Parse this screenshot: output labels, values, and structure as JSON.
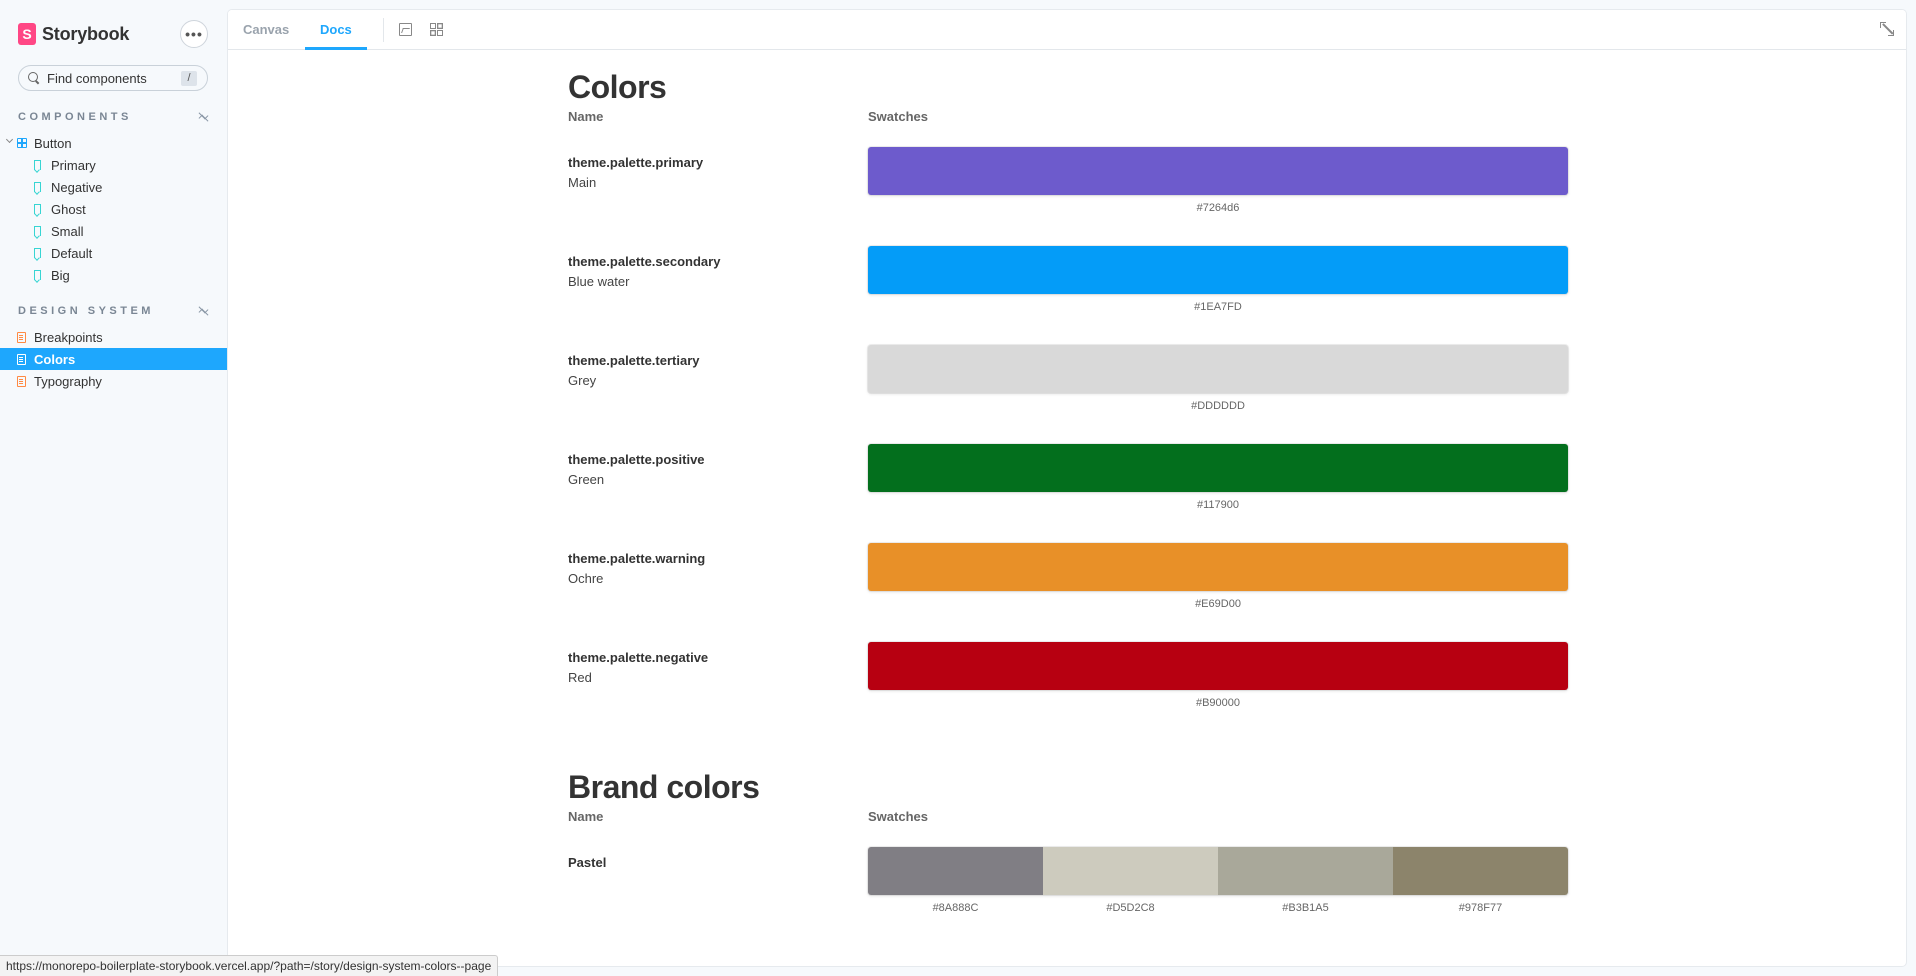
{
  "app": {
    "name": "Storybook",
    "menu_label": "•••"
  },
  "search": {
    "placeholder": "Find components",
    "shortcut": "/"
  },
  "sidebar": {
    "components_heading": "COMPONENTS",
    "component_group": "Button",
    "stories": [
      "Primary",
      "Negative",
      "Ghost",
      "Small",
      "Default",
      "Big"
    ],
    "design_heading": "DESIGN SYSTEM",
    "docs": [
      "Breakpoints",
      "Colors",
      "Typography"
    ],
    "active_doc": "Colors"
  },
  "toolbar": {
    "tabs": [
      "Canvas",
      "Docs"
    ],
    "active_tab": "Docs"
  },
  "colors_section": {
    "title": "Colors",
    "col_name": "Name",
    "col_swatches": "Swatches",
    "rows": [
      {
        "name": "theme.palette.primary",
        "desc": "Main",
        "hex": "#7264d6",
        "color": "#6d5bcc"
      },
      {
        "name": "theme.palette.secondary",
        "desc": "Blue water",
        "hex": "#1EA7FD",
        "color": "#049cf8"
      },
      {
        "name": "theme.palette.tertiary",
        "desc": "Grey",
        "hex": "#DDDDDD",
        "color": "#d9d9d9"
      },
      {
        "name": "theme.palette.positive",
        "desc": "Green",
        "hex": "#117900",
        "color": "#036f1d"
      },
      {
        "name": "theme.palette.warning",
        "desc": "Ochre",
        "hex": "#E69D00",
        "color": "#e89028"
      },
      {
        "name": "theme.palette.negative",
        "desc": "Red",
        "hex": "#B90000",
        "color": "#b70011"
      }
    ]
  },
  "brand_section": {
    "title": "Brand colors",
    "col_name": "Name",
    "col_swatches": "Swatches",
    "row_name": "Pastel",
    "swatches": [
      {
        "hex": "#8A888C",
        "color": "#807e84"
      },
      {
        "hex": "#D5D2C8",
        "color": "#cdcbbe"
      },
      {
        "hex": "#B3B1A5",
        "color": "#a9a89a"
      },
      {
        "hex": "#978F77",
        "color": "#8c846b"
      }
    ]
  },
  "status_url": "https://monorepo-boilerplate-storybook.vercel.app/?path=/story/design-system-colors--page"
}
